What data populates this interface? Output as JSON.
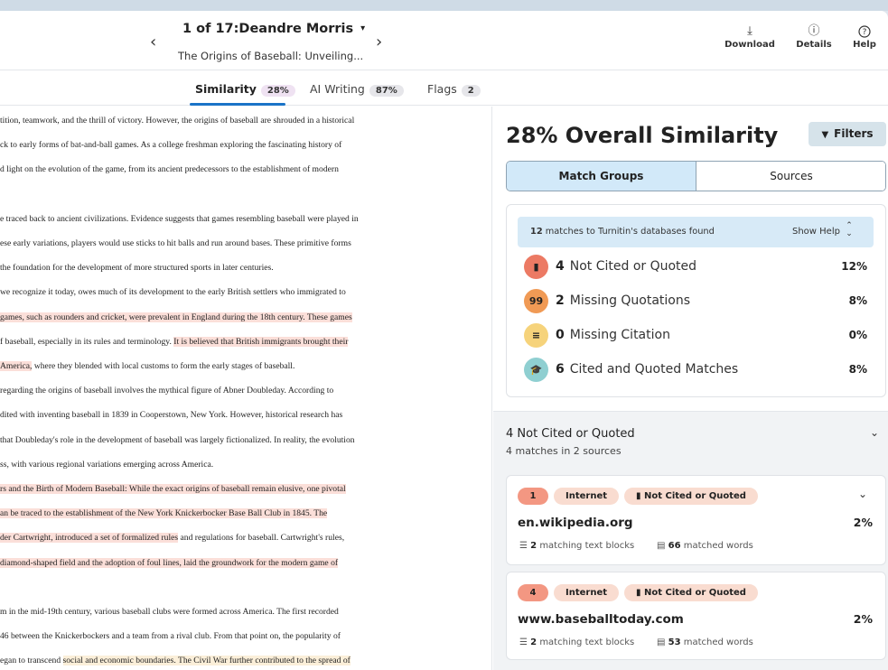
{
  "header": {
    "nav_prev": "‹",
    "nav_next": "›",
    "student_label": "1 of 17:Deandre Morris",
    "caret": "▾",
    "doc_title": "The Origins of Baseball: Unveiling...",
    "download_icon": "⤓",
    "download_label": "Download",
    "details_icon": "ⓘ",
    "details_label": "Details",
    "help_icon": "?",
    "help_label": "Help"
  },
  "tabs": [
    {
      "label": "Similarity",
      "badge": "28%"
    },
    {
      "label": "AI Writing",
      "badge": "87%"
    },
    {
      "label": "Flags",
      "badge": "2"
    }
  ],
  "document": {
    "lines": [
      {
        "segments": [
          {
            "text": "tition, teamwork, and the thrill of victory. However, the origins of baseball are shrouded in a historical",
            "hl": ""
          }
        ]
      },
      {
        "segments": [
          {
            "text": "ck to early forms of bat-and-ball games. As a college freshman exploring the fascinating history of",
            "hl": ""
          }
        ]
      },
      {
        "segments": [
          {
            "text": "d light on the evolution of the game, from its ancient predecessors to the establishment of modern",
            "hl": ""
          }
        ]
      },
      {
        "segments": []
      },
      {
        "segments": [
          {
            "text": "e traced back to ancient civilizations. Evidence suggests that games resembling baseball were played in",
            "hl": ""
          }
        ]
      },
      {
        "segments": [
          {
            "text": "ese early variations, players would use sticks to hit balls and run around bases. These primitive forms",
            "hl": ""
          }
        ]
      },
      {
        "segments": [
          {
            "text": "the foundation for the development of more structured sports in later centuries.",
            "hl": ""
          }
        ]
      },
      {
        "segments": [
          {
            "text": "we recognize it today, owes much of its development to the early British settlers who immigrated to",
            "hl": ""
          }
        ]
      },
      {
        "segments": [
          {
            "text": "games, such as rounders and cricket, were prevalent in England during the 18th century. These games",
            "hl": "hl"
          }
        ]
      },
      {
        "segments": [
          {
            "text": "f baseball, especially in its rules and terminology. ",
            "hl": ""
          },
          {
            "text": "It is believed that British immigrants brought their",
            "hl": "hl"
          }
        ]
      },
      {
        "segments": [
          {
            "text": " America,",
            "hl": "hl"
          },
          {
            "text": " where they blended with local customs to form the early stages of baseball.",
            "hl": ""
          }
        ]
      },
      {
        "segments": [
          {
            "text": "regarding the origins of baseball involves the mythical figure of Abner Doubleday. According to",
            "hl": ""
          }
        ]
      },
      {
        "segments": [
          {
            "text": "dited with inventing baseball in 1839 in Cooperstown, New York. However, historical research has",
            "hl": ""
          }
        ]
      },
      {
        "segments": [
          {
            "text": "that Doubleday's role in the development of baseball was largely fictionalized. In reality, the evolution",
            "hl": ""
          }
        ]
      },
      {
        "segments": [
          {
            "text": "ss, with various regional variations emerging across America.",
            "hl": ""
          }
        ]
      },
      {
        "segments": [
          {
            "text": "rs and the Birth of Modern Baseball: While the exact origins of baseball remain elusive, one pivotal",
            "hl": "hl"
          }
        ]
      },
      {
        "segments": [
          {
            "text": "an be traced to the establishment of the New York Knickerbocker Base Ball Club in 1845. The",
            "hl": "hl"
          }
        ]
      },
      {
        "segments": [
          {
            "text": "der Cartwright, introduced a set of formalized rules",
            "hl": "hl"
          },
          {
            "text": " and regulations for baseball. Cartwright's rules,",
            "hl": ""
          }
        ]
      },
      {
        "segments": [
          {
            "text": "diamond-shaped field and the adoption of foul lines, laid the groundwork for the modern game of",
            "hl": "hl"
          }
        ]
      },
      {
        "segments": []
      },
      {
        "segments": [
          {
            "text": "m in the mid-19th century, various baseball clubs were formed across America. The first recorded",
            "hl": ""
          }
        ]
      },
      {
        "segments": [
          {
            "text": "46 between the Knickerbockers and a team from a rival club. From that point on, the popularity of",
            "hl": ""
          }
        ]
      },
      {
        "segments": [
          {
            "text": "egan to transcend ",
            "hl": ""
          },
          {
            "text": "social and economic boundaries. The Civil War further contributed to the spread of",
            "hl": "hly"
          }
        ]
      }
    ]
  },
  "panel": {
    "overall": "28% Overall Similarity",
    "filters_icon": "▼",
    "filters_label": "Filters",
    "seg_match_groups": "Match Groups",
    "seg_sources": "Sources",
    "banner_count": "12",
    "banner_text": "matches to Turnitin's databases found",
    "show_help": "Show Help",
    "categories": [
      {
        "count": "4",
        "label": "Not Cited or Quoted",
        "pct": "12%",
        "icon": "▮",
        "color": "#ec7a64"
      },
      {
        "count": "2",
        "label": "Missing Quotations",
        "pct": "8%",
        "icon": "99",
        "color": "#f09a55"
      },
      {
        "count": "0",
        "label": "Missing Citation",
        "pct": "0%",
        "icon": "≡",
        "color": "#f6d37b"
      },
      {
        "count": "6",
        "label": "Cited and Quoted Matches",
        "pct": "8%",
        "icon": "🎓",
        "color": "#8fcfd1"
      }
    ],
    "group": {
      "title": "4  Not Cited or Quoted",
      "subtitle": "4 matches in 2 sources",
      "chevron": "⌄"
    },
    "cards": [
      {
        "num": "1",
        "type": "Internet",
        "category": "Not Cited or Quoted",
        "host": "en.wikipedia.org",
        "pct": "2%",
        "blocks": "2",
        "blocks_label": "matching text blocks",
        "words": "66",
        "words_label": "matched words"
      },
      {
        "num": "4",
        "type": "Internet",
        "category": "Not Cited or Quoted",
        "host": "www.baseballtoday.com",
        "pct": "2%",
        "blocks": "2",
        "blocks_label": "matching text blocks",
        "words": "53",
        "words_label": "matched words"
      }
    ]
  }
}
